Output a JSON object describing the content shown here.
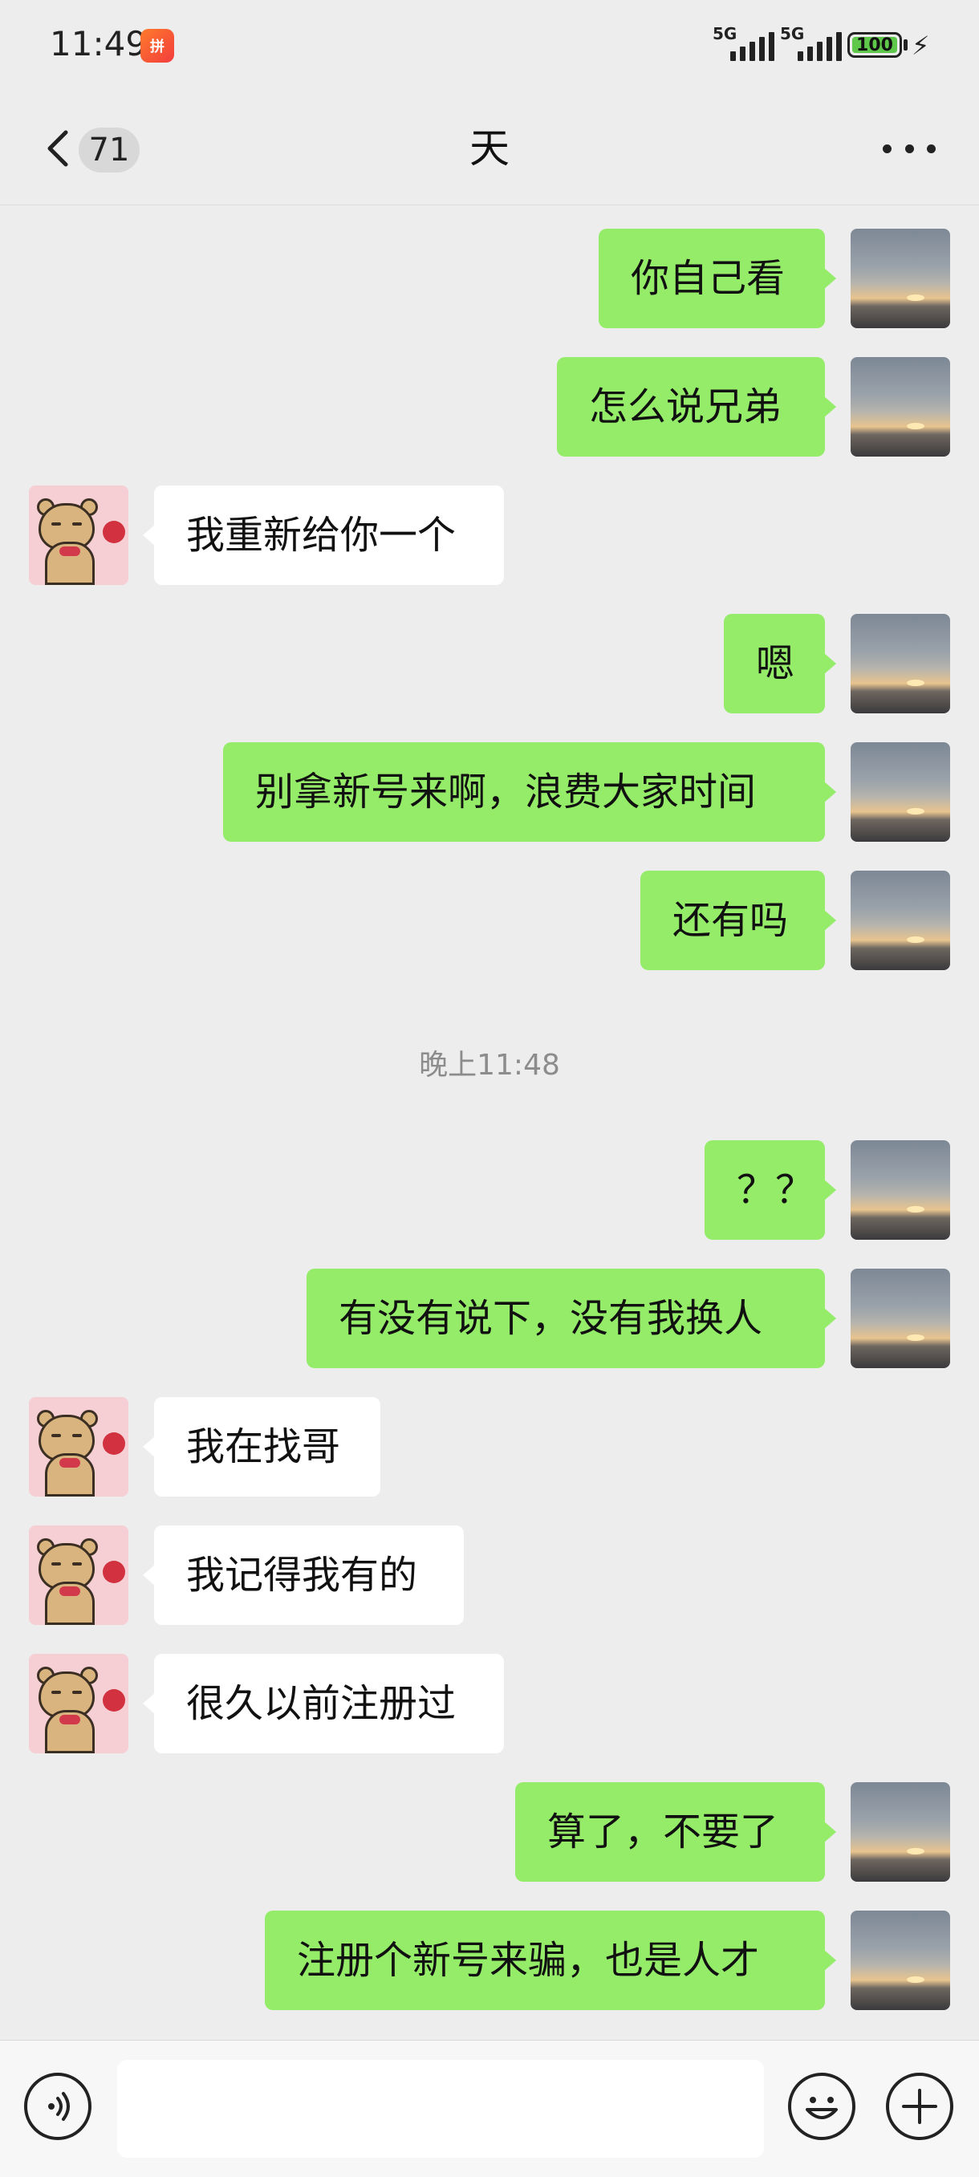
{
  "status_bar": {
    "time": "11:49",
    "app_icon_text": "拼",
    "signal_1_label": "5G",
    "signal_2_label": "5G",
    "battery_level": "100",
    "charging_icon": "bolt-icon"
  },
  "header": {
    "back_icon": "chevron-left-icon",
    "unread_count": "71",
    "title": "天",
    "more_icon": "more-dots-icon"
  },
  "colors": {
    "self_bubble": "#95ec69",
    "other_bubble": "#ffffff",
    "background": "#ededed"
  },
  "messages": [
    {
      "side": "self",
      "text": "你自己看"
    },
    {
      "side": "self",
      "text": "怎么说兄弟"
    },
    {
      "side": "other",
      "text": "我重新给你一个"
    },
    {
      "side": "self",
      "text": "嗯"
    },
    {
      "side": "self",
      "text": "别拿新号来啊，浪费大家时间"
    },
    {
      "side": "self",
      "text": "还有吗"
    },
    {
      "side": "self",
      "text": "？？"
    },
    {
      "side": "self",
      "text": "有没有说下，没有我换人"
    },
    {
      "side": "other",
      "text": "我在找哥"
    },
    {
      "side": "other",
      "text": "我记得我有的"
    },
    {
      "side": "other",
      "text": "很久以前注册过"
    },
    {
      "side": "self",
      "text": "算了，不要了"
    },
    {
      "side": "self",
      "text": "注册个新号来骗，也是人才"
    }
  ],
  "timestamp": "晚上11:48",
  "input_bar": {
    "voice_icon": "voice-icon",
    "text_value": "",
    "emoji_icon": "emoji-icon",
    "plus_icon": "plus-icon"
  }
}
